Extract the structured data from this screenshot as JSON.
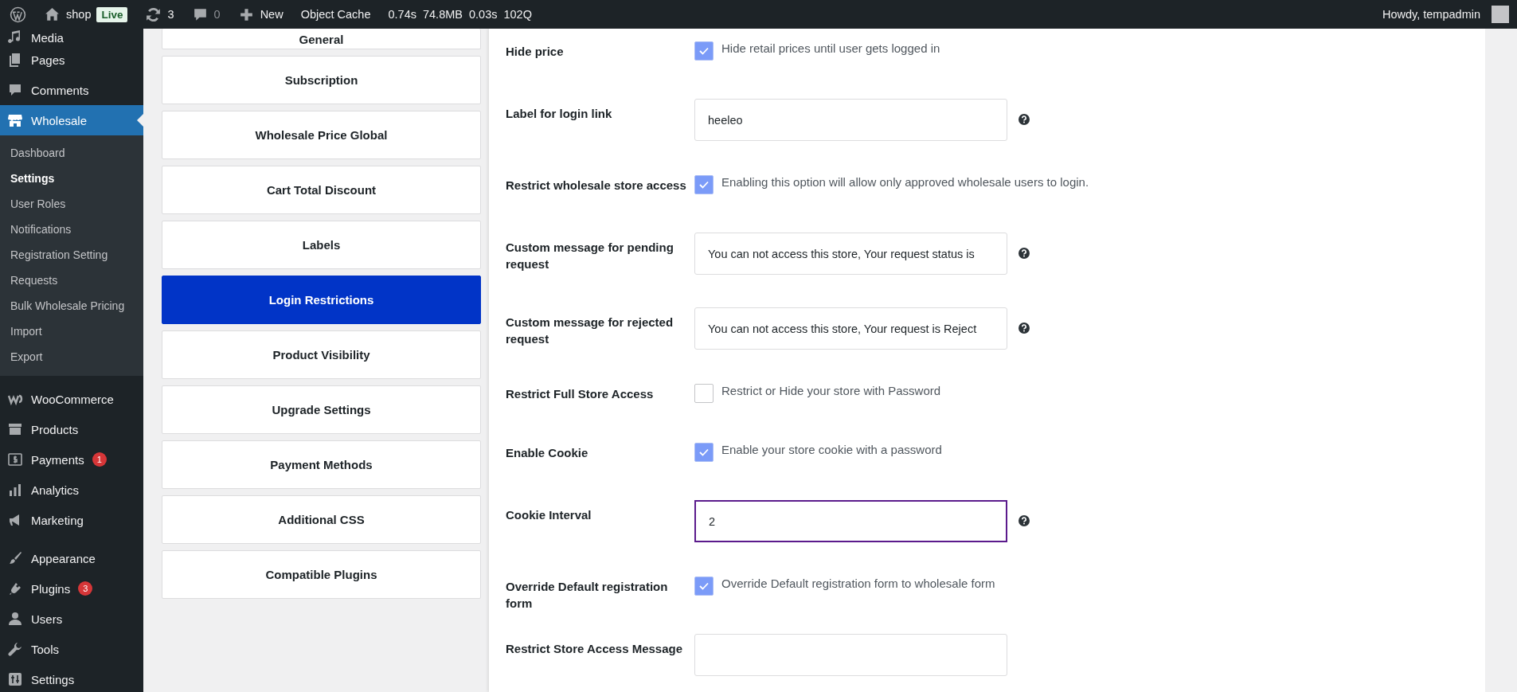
{
  "admin_bar": {
    "site": "shop",
    "status": "Live",
    "updates": "3",
    "comments": "0",
    "new": "New",
    "object_cache": "Object Cache",
    "stats": [
      "0.74s",
      "74.8MB",
      "0.03s",
      "102Q"
    ],
    "greeting": "Howdy, tempadmin"
  },
  "sidebar": {
    "groups": [
      [
        {
          "label": "Media",
          "selected": false
        },
        {
          "label": "Pages",
          "selected": false
        },
        {
          "label": "Comments",
          "selected": false
        },
        {
          "label": "Wholesale",
          "selected": true,
          "children": [
            {
              "label": "Dashboard",
              "selected": false
            },
            {
              "label": "Settings",
              "selected": true
            },
            {
              "label": "User Roles",
              "selected": false
            },
            {
              "label": "Notifications",
              "selected": false
            },
            {
              "label": "Registration Setting",
              "selected": false
            },
            {
              "label": "Requests",
              "selected": false
            },
            {
              "label": "Bulk Wholesale Pricing",
              "selected": false
            },
            {
              "label": "Import",
              "selected": false
            },
            {
              "label": "Export",
              "selected": false
            }
          ]
        }
      ],
      [
        {
          "label": "WooCommerce",
          "selected": false
        },
        {
          "label": "Products",
          "selected": false
        },
        {
          "label": "Payments",
          "selected": false,
          "badge": "1"
        },
        {
          "label": "Analytics",
          "selected": false
        },
        {
          "label": "Marketing",
          "selected": false
        }
      ],
      [
        {
          "label": "Appearance",
          "selected": false
        },
        {
          "label": "Plugins",
          "selected": false,
          "badge": "3"
        },
        {
          "label": "Users",
          "selected": false
        },
        {
          "label": "Tools",
          "selected": false
        },
        {
          "label": "Settings",
          "selected": false
        }
      ]
    ]
  },
  "settings_tabs": [
    {
      "label": "General",
      "selected": false
    },
    {
      "label": "Subscription",
      "selected": false
    },
    {
      "label": "Wholesale Price Global",
      "selected": false
    },
    {
      "label": "Cart Total Discount",
      "selected": false
    },
    {
      "label": "Labels",
      "selected": false
    },
    {
      "label": "Login Restrictions",
      "selected": true
    },
    {
      "label": "Product Visibility",
      "selected": false
    },
    {
      "label": "Upgrade Settings",
      "selected": false
    },
    {
      "label": "Payment Methods",
      "selected": false
    },
    {
      "label": "Additional CSS",
      "selected": false
    },
    {
      "label": "Compatible Plugins",
      "selected": false
    }
  ],
  "form_rows": [
    {
      "kind": "checkbox",
      "label": "Hide price",
      "checked": true,
      "text": "Hide retail prices until user gets logged in"
    },
    {
      "kind": "input",
      "label": "Label for login link",
      "value": "heeleo",
      "focused": false,
      "help": true
    },
    {
      "kind": "checkbox",
      "label": "Restrict wholesale store access",
      "checked": true,
      "text": "Enabling this option will allow only approved wholesale users to login."
    },
    {
      "kind": "input",
      "label": "Custom message for pending request",
      "value": "You can not access this store, Your request status is",
      "focused": false,
      "help": true
    },
    {
      "kind": "input",
      "label": "Custom message for rejected request",
      "value": "You can not access this store, Your request is Reject",
      "focused": false,
      "help": true
    },
    {
      "kind": "checkbox",
      "label": "Restrict Full Store Access",
      "checked": false,
      "text": "Restrict or Hide your store with Password"
    },
    {
      "kind": "checkbox",
      "label": "Enable Cookie",
      "checked": true,
      "text": "Enable your store cookie with a password"
    },
    {
      "kind": "input",
      "label": "Cookie Interval",
      "value": "2",
      "focused": true,
      "help": true
    },
    {
      "kind": "checkbox",
      "label": "Override Default registration form",
      "checked": true,
      "text": "Override Default registration form to wholesale form"
    },
    {
      "kind": "input",
      "label": "Restrict Store Access Message",
      "focused": false,
      "help": false
    }
  ]
}
